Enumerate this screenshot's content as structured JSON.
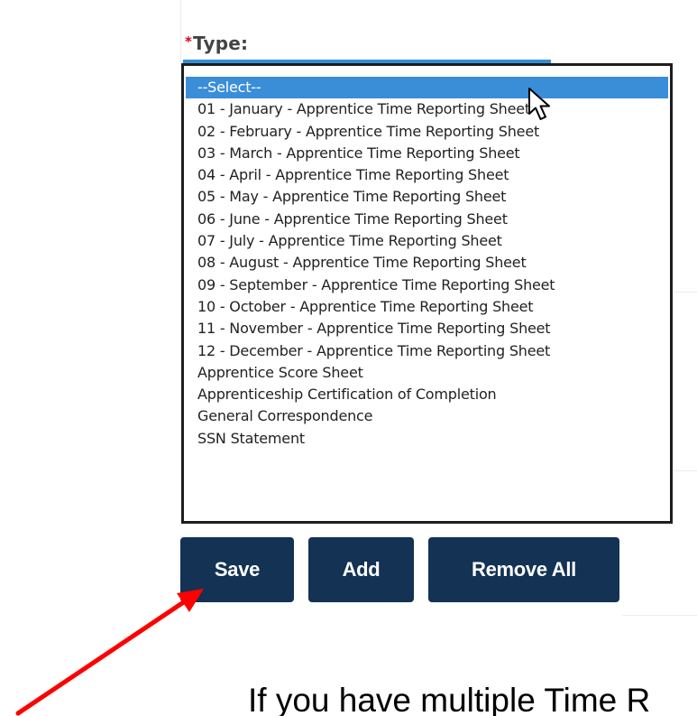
{
  "field": {
    "required_mark": "*",
    "label": "Type:"
  },
  "type_options": [
    "--Select--",
    "01 - January - Apprentice Time Reporting Sheet",
    "02 - February - Apprentice Time Reporting Sheet",
    "03 - March - Apprentice Time Reporting Sheet",
    "04 - April - Apprentice Time Reporting Sheet",
    "05 - May - Apprentice Time Reporting Sheet",
    "06 - June - Apprentice Time Reporting Sheet",
    "07 - July - Apprentice Time Reporting Sheet",
    "08 - August - Apprentice Time Reporting Sheet",
    "09 - September - Apprentice Time Reporting Sheet",
    "10 - October - Apprentice Time Reporting Sheet",
    "11 - November - Apprentice Time Reporting Sheet",
    "12 - December - Apprentice Time Reporting Sheet",
    "Apprentice Score Sheet",
    "Apprenticeship Certification of Completion",
    "General Correspondence",
    "SSN Statement"
  ],
  "selected_option": "--Select--",
  "buttons": {
    "save": "Save",
    "add": "Add",
    "remove_all": "Remove All"
  },
  "caption": "If you have multiple Time R",
  "icons": {
    "pointer": "mouse-pointer-icon",
    "annotation": "red-arrow-annotation"
  },
  "colors": {
    "button_bg": "#133254",
    "selection_bg": "#3a8ed8",
    "required": "#d0021b",
    "annotation_arrow": "#ff0000"
  }
}
